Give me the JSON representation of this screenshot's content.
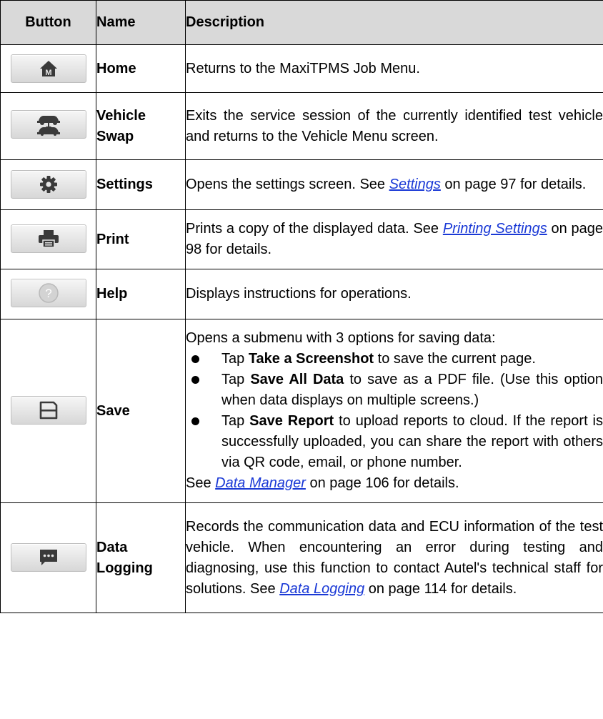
{
  "headers": {
    "button": "Button",
    "name": "Name",
    "description": "Description"
  },
  "rows": [
    {
      "icon": "home-icon",
      "name": "Home",
      "desc": "Returns to the MaxiTPMS Job Menu."
    },
    {
      "icon": "vehicle-swap-icon",
      "name_line1": "Vehicle",
      "name_line2": "Swap",
      "desc": "Exits the service session of the currently identified test vehicle and returns to the Vehicle Menu screen."
    },
    {
      "icon": "gear-icon",
      "name": "Settings",
      "desc_pre": "Opens the settings screen. See ",
      "link": "Settings",
      "desc_post": " on page 97 for details."
    },
    {
      "icon": "printer-icon",
      "name": "Print",
      "desc_pre": "Prints a copy of the displayed data. See ",
      "link": "Printing Settings",
      "desc_post": " on page 98 for details."
    },
    {
      "icon": "help-icon",
      "name": "Help",
      "desc": "Displays instructions for operations."
    },
    {
      "icon": "save-icon",
      "name": "Save",
      "intro": "Opens a submenu with 3 options for saving data:",
      "options": [
        {
          "pre": "Tap ",
          "bold": "Take a Screenshot",
          "post": " to save the current page."
        },
        {
          "pre": "Tap ",
          "bold": "Save All Data",
          "post": " to save as a PDF file. (Use this option when data displays on multiple screens.)"
        },
        {
          "pre": "Tap ",
          "bold": "Save Report",
          "post": " to upload reports to cloud. If the report is successfully uploaded, you can share the report with others via QR code, email, or phone number."
        }
      ],
      "see_pre": "See ",
      "see_link": "Data Manager",
      "see_post": " on page 106 for details."
    },
    {
      "icon": "chat-icon",
      "name_line1": "Data",
      "name_line2": "Logging",
      "desc_pre": "Records the communication data and ECU information of the test vehicle. When encountering an error during testing and diagnosing, use this function to contact Autel's technical staff for solutions. See ",
      "link": "Data Logging",
      "desc_post": " on page 114 for details."
    }
  ],
  "colors": {
    "header_bg": "#d9d9d9",
    "link": "#1a39d6",
    "icon_dark": "#3a3a3a",
    "help_icon": "#b9b9b9"
  }
}
